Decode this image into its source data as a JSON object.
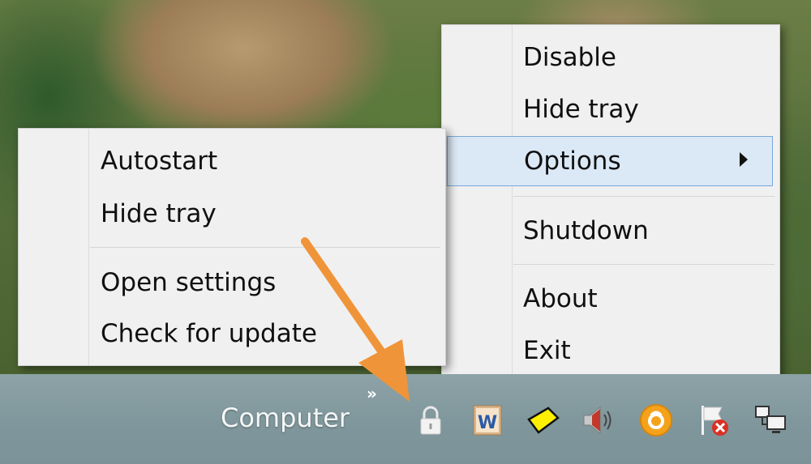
{
  "main_menu": {
    "items": [
      {
        "label": "Disable"
      },
      {
        "label": "Hide tray"
      },
      {
        "label": "Options",
        "has_submenu": true,
        "highlighted": true
      },
      {
        "label": "Shutdown"
      },
      {
        "label": "About"
      },
      {
        "label": "Exit"
      }
    ]
  },
  "options_submenu": {
    "items": [
      {
        "label": "Autostart"
      },
      {
        "label": "Hide tray"
      },
      {
        "label": "Open settings"
      },
      {
        "label": "Check for update"
      }
    ]
  },
  "taskbar": {
    "toolbar_label": "Computer",
    "overflow_chevron": "»",
    "tray_icons": [
      "lock-icon",
      "word-icon",
      "yellow-diamond-icon",
      "speaker-icon",
      "orange-circle-icon",
      "action-center-flag-icon",
      "network-icon"
    ]
  },
  "colors": {
    "menu_background": "#f0f0f0",
    "highlight_background": "#dbe8f6",
    "highlight_border": "#7aa7d8",
    "annotation_arrow": "#f0943a",
    "taskbar": "#8298a0"
  }
}
